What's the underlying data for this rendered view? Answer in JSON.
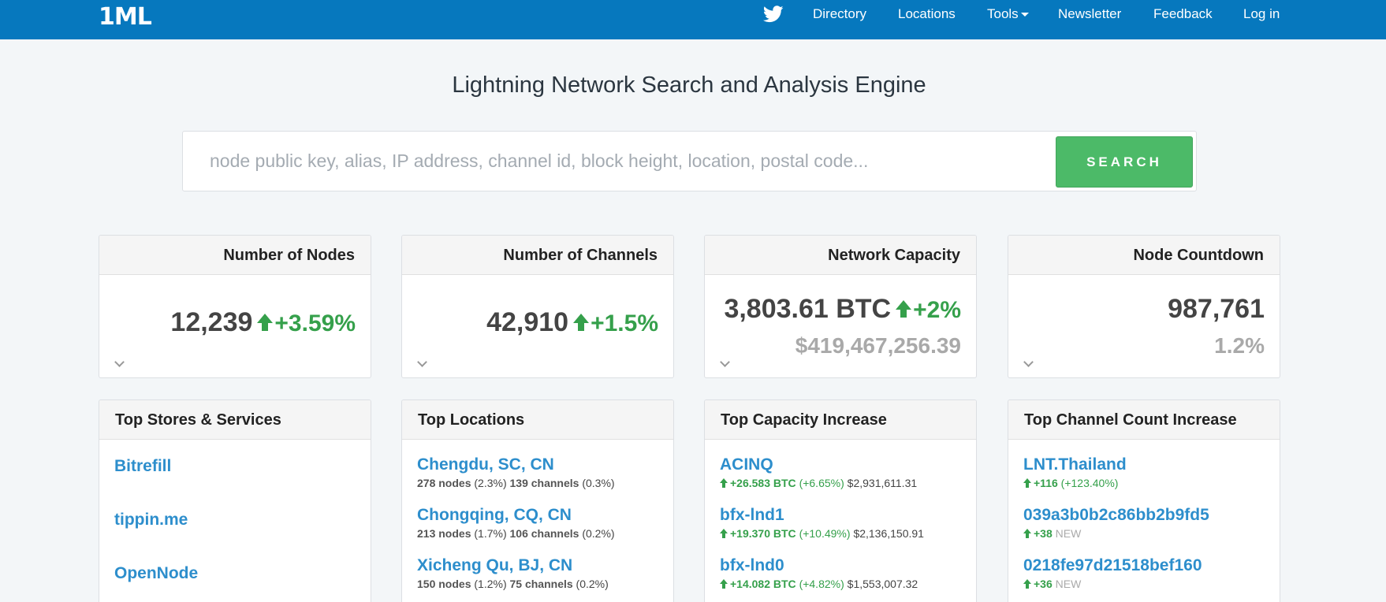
{
  "brand": "1ML",
  "nav": {
    "directory": "Directory",
    "locations": "Locations",
    "tools": "Tools",
    "newsletter": "Newsletter",
    "feedback": "Feedback",
    "login": "Log in"
  },
  "headline": "Lightning Network Search and Analysis Engine",
  "search": {
    "placeholder": "node public key, alias, IP address, channel id, block height, location, postal code...",
    "button": "SEARCH"
  },
  "stats": {
    "nodes": {
      "title": "Number of Nodes",
      "value": "12,239",
      "change": "+3.59%"
    },
    "channels": {
      "title": "Number of Channels",
      "value": "42,910",
      "change": "+1.5%"
    },
    "capacity": {
      "title": "Network Capacity",
      "value": "3,803.61 BTC",
      "change": "+2%",
      "usd": "$419,467,256.39"
    },
    "countdown": {
      "title": "Node Countdown",
      "value": "987,761",
      "percent": "1.2%"
    }
  },
  "stores": {
    "title": "Top Stores & Services",
    "items": [
      "Bitrefill",
      "tippin.me",
      "OpenNode"
    ]
  },
  "locations": {
    "title": "Top Locations",
    "items": [
      {
        "name": "Chengdu, SC, CN",
        "nodes": "278 nodes",
        "nodes_pct": "(2.3%)",
        "channels": "139 channels",
        "channels_pct": "(0.3%)"
      },
      {
        "name": "Chongqing, CQ, CN",
        "nodes": "213 nodes",
        "nodes_pct": "(1.7%)",
        "channels": "106 channels",
        "channels_pct": "(0.2%)"
      },
      {
        "name": "Xicheng Qu, BJ, CN",
        "nodes": "150 nodes",
        "nodes_pct": "(1.2%)",
        "channels": "75 channels",
        "channels_pct": "(0.2%)"
      }
    ]
  },
  "capacity_increase": {
    "title": "Top Capacity Increase",
    "items": [
      {
        "name": "ACINQ",
        "btc": "+26.583 BTC",
        "pct": "(+6.65%)",
        "usd": "$2,931,611.31"
      },
      {
        "name": "bfx-lnd1",
        "btc": "+19.370 BTC",
        "pct": "(+10.49%)",
        "usd": "$2,136,150.91"
      },
      {
        "name": "bfx-lnd0",
        "btc": "+14.082 BTC",
        "pct": "(+4.82%)",
        "usd": "$1,553,007.32"
      }
    ]
  },
  "channel_increase": {
    "title": "Top Channel Count Increase",
    "items": [
      {
        "name": "LNT.Thailand",
        "count": "+116",
        "note": "(+123.40%)"
      },
      {
        "name": "039a3b0b2c86bb2b9fd5",
        "count": "+38",
        "note": "NEW"
      },
      {
        "name": "0218fe97d21518bef160",
        "count": "+36",
        "note": "NEW"
      }
    ]
  }
}
